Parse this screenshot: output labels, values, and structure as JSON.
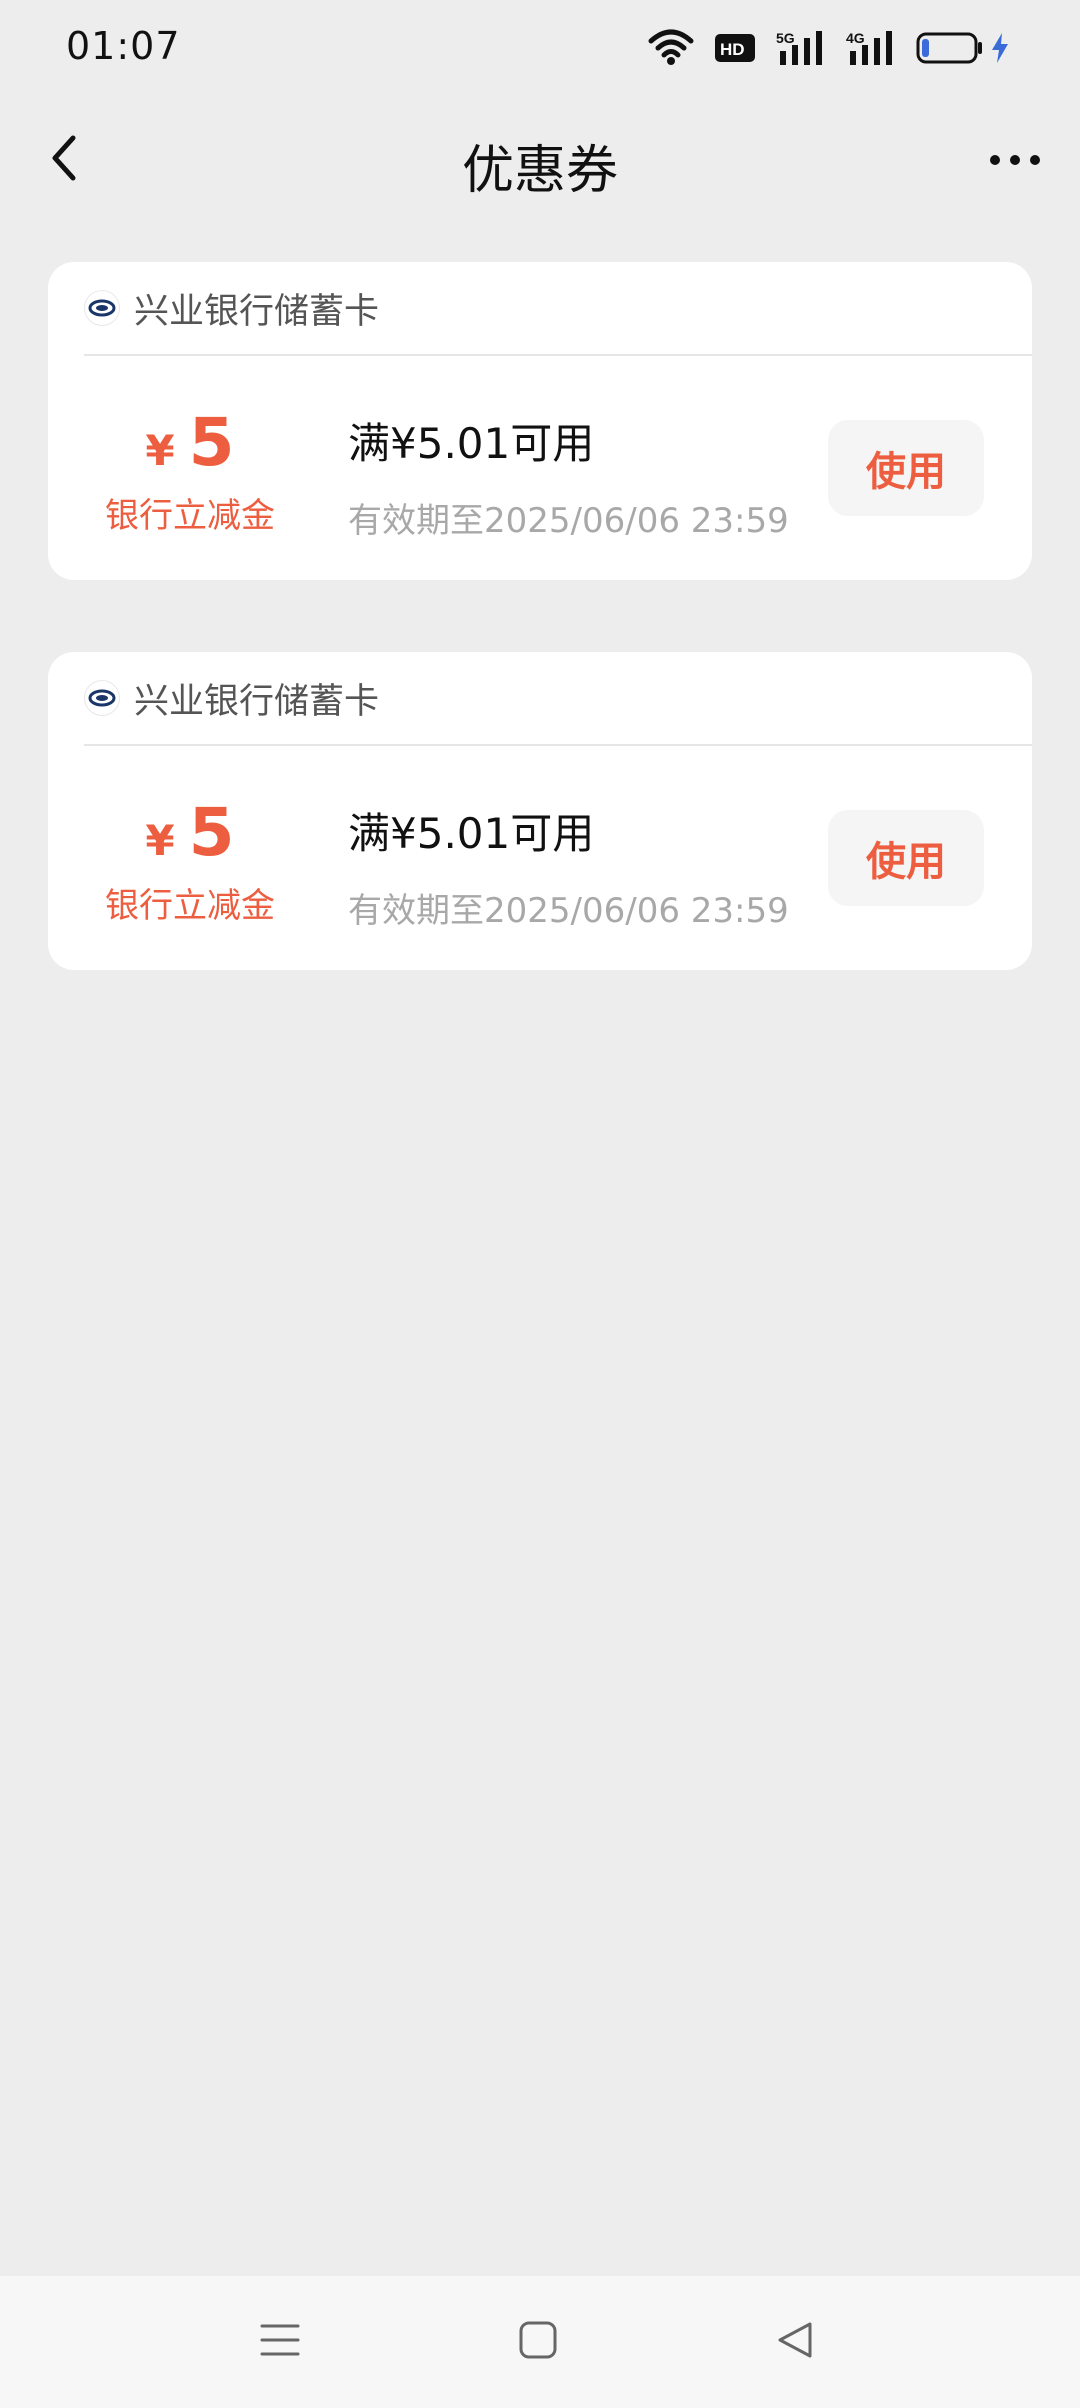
{
  "status_bar": {
    "time": "01:07",
    "icons": [
      "wifi-icon",
      "hd-icon",
      "signal-5g-icon",
      "signal-4g-icon",
      "battery-icon",
      "charging-icon"
    ],
    "hd_text": "HD",
    "net1": "5G",
    "net2": "4G"
  },
  "nav": {
    "title": "优惠券",
    "back_icon": "chevron-left-icon",
    "more_icon": "more-icon"
  },
  "coupons": [
    {
      "bank": "兴业银行储蓄卡",
      "currency": "¥",
      "amount": "5",
      "amount_label": "银行立减金",
      "condition": "满¥5.01可用",
      "expiry": "有效期至2025/06/06 23:59",
      "button": "使用"
    },
    {
      "bank": "兴业银行储蓄卡",
      "currency": "¥",
      "amount": "5",
      "amount_label": "银行立减金",
      "condition": "满¥5.01可用",
      "expiry": "有效期至2025/06/06 23:59",
      "button": "使用"
    }
  ],
  "colors": {
    "accent": "#ec5e3f",
    "background": "#ededed",
    "card": "#ffffff",
    "bank_logo": "#1a3668"
  },
  "system_nav": [
    "menu-icon",
    "home-icon",
    "back-triangle-icon"
  ]
}
